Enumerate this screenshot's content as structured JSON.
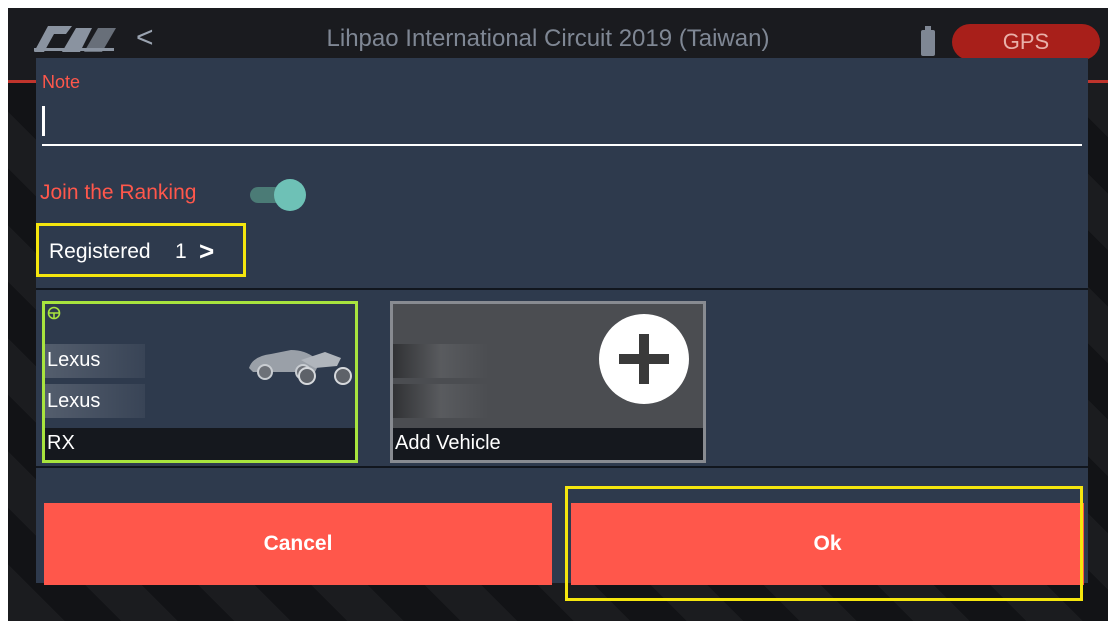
{
  "topbar": {
    "back_glyph": "<",
    "title": "Lihpao International Circuit 2019 (Taiwan)",
    "gps_label": "GPS"
  },
  "dialog": {
    "note_label": "Note",
    "note_value": "",
    "join_label": "Join the Ranking",
    "join_enabled": true,
    "registered_label": "Registered",
    "registered_count": "1",
    "registered_chevron": ">",
    "vehicle": {
      "make": "Lexus",
      "brand": "Lexus",
      "model": "RX",
      "icon": "car-icon"
    },
    "add_vehicle_label": "Add Vehicle",
    "cancel_label": "Cancel",
    "ok_label": "Ok"
  },
  "colors": {
    "accent": "#ff574b",
    "dialog_bg": "#2e3a4d",
    "highlight_yellow": "#f5e60e",
    "highlight_green": "#a8e43e",
    "toggle_on": "#6ec1b6"
  }
}
